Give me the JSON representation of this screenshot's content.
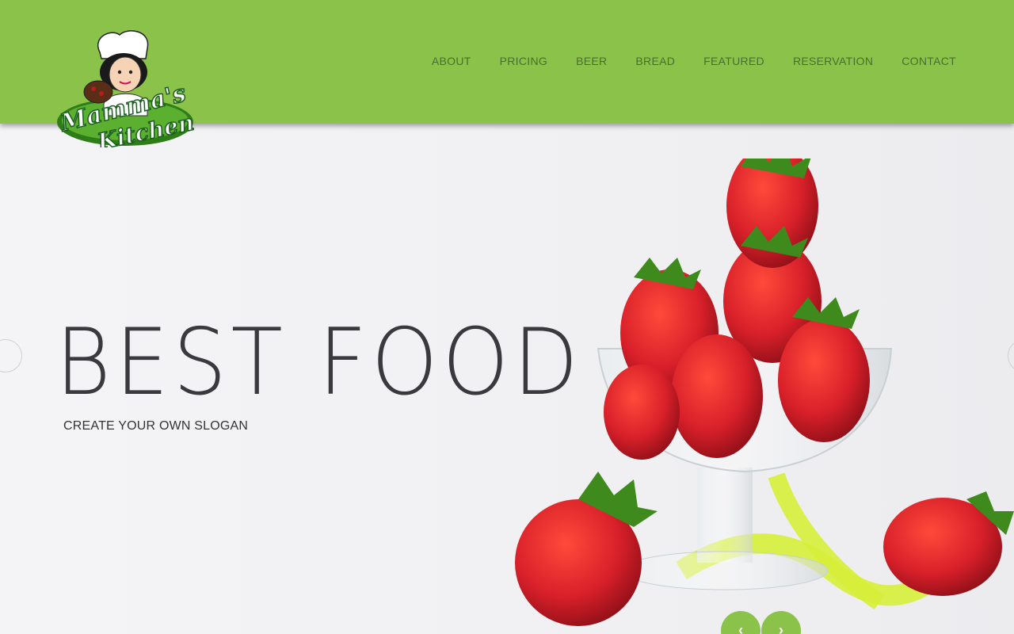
{
  "brand": {
    "logo_text_line1": "Mamma's",
    "logo_text_line2": "Kitchen"
  },
  "nav": {
    "items": [
      {
        "label": "ABOUT"
      },
      {
        "label": "PRICING"
      },
      {
        "label": "BEER"
      },
      {
        "label": "BREAD"
      },
      {
        "label": "FEATURED"
      },
      {
        "label": "RESERVATION"
      },
      {
        "label": "CONTACT"
      }
    ]
  },
  "hero": {
    "headline": "BEST FOOD",
    "slogan": "CREATE YOUR OWN SLOGAN"
  },
  "slider": {
    "prev_icon": "chevron-left-icon",
    "next_icon": "chevron-right-icon",
    "prev_glyph": "‹",
    "next_glyph": "›"
  },
  "colors": {
    "header_bg": "#8bc34a",
    "nav_text": "#3e5f2c",
    "headline": "#3a3a3e",
    "accent": "#8bc34a",
    "strawberry": "#d8202a"
  }
}
